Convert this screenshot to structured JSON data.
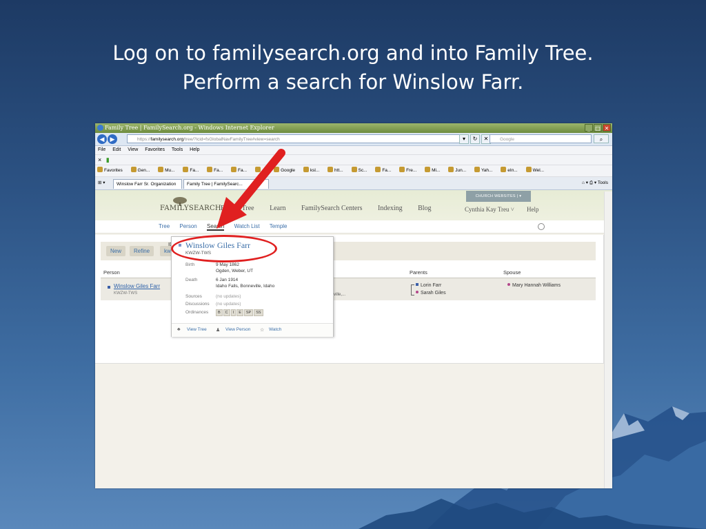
{
  "slide": {
    "title_line1": "Log on to familysearch.org and into Family Tree.",
    "title_line2": "Perform a search for Winslow Farr."
  },
  "browser": {
    "window_title": "Family Tree | FamilySearch.org - Windows Internet Explorer",
    "address_prefix": "https://",
    "address_domain": "familysearch.org",
    "address_rest": "/tree/?icid=fsGlobalNavFamilyTree#view=search",
    "search_placeholder": "Google",
    "menu": [
      "File",
      "Edit",
      "View",
      "Favorites",
      "Tools",
      "Help"
    ],
    "favorites_label": "Favorites",
    "favorites": [
      "Gen...",
      "Mu...",
      "Fa...",
      "Fa...",
      "Fa...",
      "...",
      "Google",
      "ksl...",
      "htt...",
      "Sc...",
      "Fa...",
      "Fre...",
      "Mi...",
      "Jun...",
      "Yah...",
      "eIn...",
      "Wel..."
    ],
    "tabs": [
      "Winslow Farr Sr. Organization",
      "Family Tree | FamilySearc..."
    ],
    "tools_label": "Tools"
  },
  "site": {
    "logo": "FAMILYSEARCH",
    "nav": [
      "Family Tree",
      "Learn",
      "FamilySearch Centers",
      "Indexing",
      "Blog"
    ],
    "church_websites": "CHURCH WEBSITES",
    "user": "Cynthia Kay Treu",
    "help": "Help",
    "subnav": [
      "Tree",
      "Person",
      "Search",
      "Watch List",
      "Temple"
    ],
    "active_subnav": "Search"
  },
  "search": {
    "buttons": [
      "New",
      "Refine",
      "kw"
    ],
    "id_label": "ID",
    "columns": [
      "Person",
      "Parents",
      "Spouse"
    ],
    "result": {
      "name": "Winslow Giles Farr",
      "id": "KWZW-TWS",
      "residence_snippet": "ville,...",
      "parents": [
        "Lorin Farr",
        "Sarah Giles"
      ],
      "spouse": "Mary Hannah Williams"
    }
  },
  "popup": {
    "name": "Winslow Giles Farr",
    "id": "KWZW-TWS",
    "birth_label": "Birth",
    "birth_date": "9 May 1862",
    "birth_place": "Ogden, Weber, UT",
    "death_label": "Death",
    "death_date": "6 Jan 1914",
    "death_place": "Idaho Falls, Bonneville, Idaho",
    "sources_label": "Sources",
    "sources_value": "(no updates)",
    "discussions_label": "Discussions",
    "discussions_value": "(no updates)",
    "ordinances_label": "Ordinances",
    "ordinances": [
      "B",
      "C",
      "I",
      "E",
      "SP",
      "SS"
    ],
    "links": [
      "View Tree",
      "View Person",
      "Watch"
    ]
  },
  "colors": {
    "annotation": "#e02020",
    "link": "#3a6ea8",
    "slide_background": "#2c5283"
  }
}
